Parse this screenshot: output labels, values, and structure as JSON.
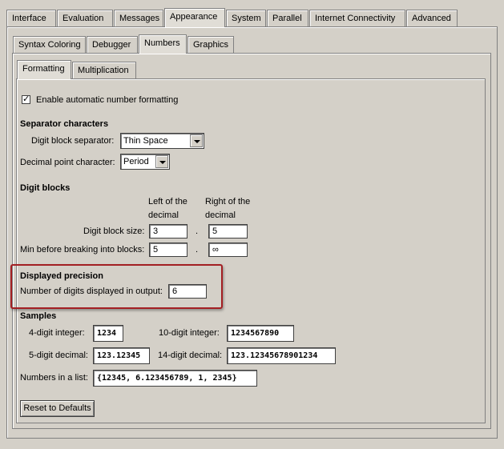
{
  "top_tabs": [
    "Interface",
    "Evaluation",
    "Messages",
    "Appearance",
    "System",
    "Parallel",
    "Internet Connectivity",
    "Advanced"
  ],
  "sub_tabs": [
    "Syntax Coloring",
    "Debugger",
    "Numbers",
    "Graphics"
  ],
  "inner_tabs": [
    "Formatting",
    "Multiplication"
  ],
  "enable_label": "Enable automatic number formatting",
  "separator": {
    "heading": "Separator characters",
    "digit_block_label": "Digit block separator:",
    "digit_block_value": "Thin Space",
    "decimal_point_label": "Decimal point character:",
    "decimal_point_value": "Period"
  },
  "digit_blocks": {
    "heading": "Digit blocks",
    "left_header_1": "Left of the",
    "left_header_2": "decimal",
    "right_header_1": "Right of the",
    "right_header_2": "decimal",
    "size_label": "Digit block size:",
    "size_left": "3",
    "size_right": "5",
    "min_label": "Min before breaking into blocks:",
    "min_left": "5",
    "min_right": "∞",
    "dot": "."
  },
  "precision": {
    "heading": "Displayed precision",
    "label": "Number of digits displayed in output:",
    "value": "6"
  },
  "samples": {
    "heading": "Samples",
    "int4_label": "4-digit integer:",
    "int4_value": "1234",
    "int10_label": "10-digit integer:",
    "int10_value": "1234567890",
    "dec5_label": "5-digit decimal:",
    "dec5_value": "123.12345",
    "dec14_label": "14-digit decimal:",
    "dec14_value": "123.12345678901234",
    "list_label": "Numbers in a list:",
    "list_value": "{12345, 6.123456789, 1, 2345}"
  },
  "reset_button": "Reset to Defaults",
  "colors": {
    "background": "#d4d0c8",
    "highlight_border": "#a31f23"
  }
}
